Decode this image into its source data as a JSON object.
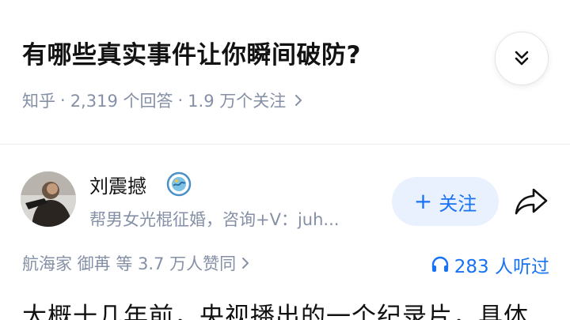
{
  "question": {
    "title": "有哪些真实事件让你瞬间破防?",
    "source": "知乎",
    "separator": "·",
    "answer_count": "2,319 个回答",
    "follow_count": "1.9 万个关注",
    "expand_icon": "chevron-double-down-icon"
  },
  "author": {
    "name": "刘震撼",
    "bio": "帮男女光棍征婚，咨询+V：juh...",
    "follow_label": "关注",
    "follow_prefix": "+"
  },
  "stats": {
    "likers": "航海家 御苒 等 3.7 万人赞同",
    "listeners": "283 人听过"
  },
  "answer": {
    "excerpt": "大概十几年前，央视播出的一个纪录片，具体"
  },
  "colors": {
    "accent": "#1772f6",
    "muted": "#8590a6",
    "text": "#121212"
  }
}
